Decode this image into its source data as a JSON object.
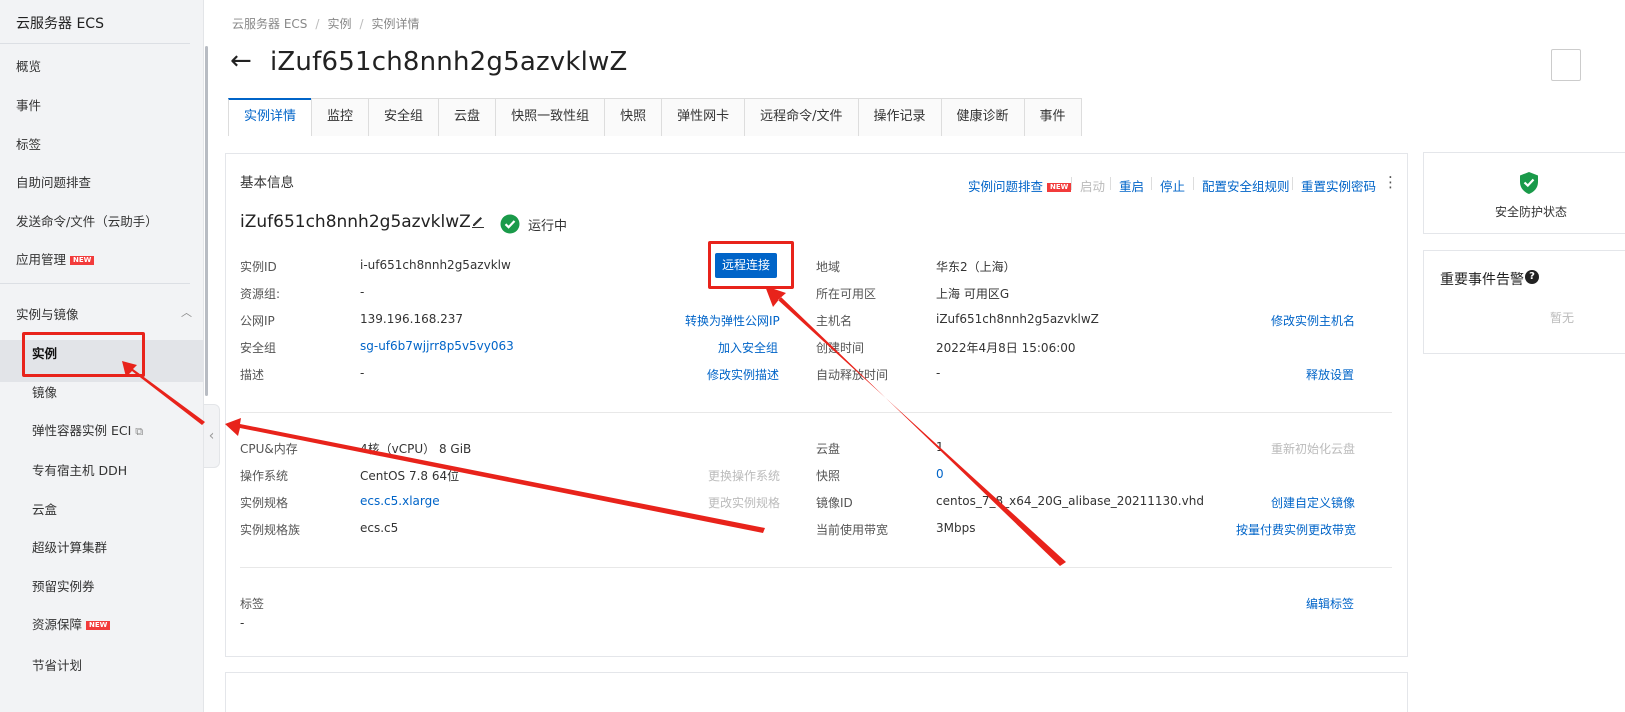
{
  "sidebar": {
    "title": "云服务器 ECS",
    "items": [
      {
        "label": "概览"
      },
      {
        "label": "事件"
      },
      {
        "label": "标签"
      },
      {
        "label": "自助问题排查"
      },
      {
        "label": "发送命令/文件（云助手）"
      },
      {
        "label": "应用管理",
        "badge": "NEW"
      }
    ],
    "group": {
      "label": "实例与镜像",
      "expanded": true
    },
    "sub_items": [
      {
        "label": "实例",
        "active": true
      },
      {
        "label": "镜像"
      },
      {
        "label": "弹性容器实例 ECI",
        "external": true
      },
      {
        "label": "专有宿主机 DDH"
      },
      {
        "label": "云盒"
      },
      {
        "label": "超级计算集群"
      },
      {
        "label": "预留实例券"
      },
      {
        "label": "资源保障",
        "badge": "NEW"
      },
      {
        "label": "节省计划"
      }
    ]
  },
  "breadcrumb": [
    "云服务器 ECS",
    "实例",
    "实例详情"
  ],
  "page_title": "iZuf651ch8nnh2g5azvklwZ",
  "tabs": [
    "实例详情",
    "监控",
    "安全组",
    "云盘",
    "快照一致性组",
    "快照",
    "弹性网卡",
    "远程命令/文件",
    "操作记录",
    "健康诊断",
    "事件"
  ],
  "active_tab": 0,
  "basic": {
    "section_title": "基本信息",
    "actions": [
      {
        "label": "实例问题排查",
        "badge": "NEW",
        "enabled": true
      },
      {
        "label": "启动",
        "enabled": false
      },
      {
        "label": "重启",
        "enabled": true
      },
      {
        "label": "停止",
        "enabled": true
      },
      {
        "label": "配置安全组规则",
        "enabled": true
      },
      {
        "label": "重置实例密码",
        "enabled": true
      }
    ],
    "instance_name": "iZuf651ch8nnh2g5azvklwZ",
    "status": "运行中",
    "remote_connect": "远程连接",
    "left_rows": [
      {
        "label": "实例ID",
        "value": "i-uf651ch8nnh2g5azvklw",
        "action": ""
      },
      {
        "label": "资源组:",
        "value": "-",
        "action": ""
      },
      {
        "label": "公网IP",
        "value": "139.196.168.237",
        "action": "转换为弹性公网IP"
      },
      {
        "label": "安全组",
        "value": "sg-uf6b7wjjrr8p5v5vy063",
        "action": "加入安全组"
      },
      {
        "label": "描述",
        "value": "-",
        "action": "修改实例描述"
      }
    ],
    "right_rows": [
      {
        "label": "地域",
        "value": "华东2（上海）",
        "action": ""
      },
      {
        "label": "所在可用区",
        "value": "上海 可用区G",
        "action": ""
      },
      {
        "label": "主机名",
        "value": "iZuf651ch8nnh2g5azvklwZ",
        "action": "修改实例主机名"
      },
      {
        "label": "创建时间",
        "value": "2022年4月8日 15:06:00",
        "action": ""
      },
      {
        "label": "自动释放时间",
        "value": "-",
        "action": "释放设置"
      }
    ]
  },
  "config": {
    "left_rows": [
      {
        "label": "CPU&内存",
        "value": "4核（vCPU） 8 GiB",
        "action": ""
      },
      {
        "label": "操作系统",
        "value": "CentOS 7.8 64位",
        "action": "更换操作系统"
      },
      {
        "label": "实例规格",
        "value": "ecs.c5.xlarge",
        "action": "更改实例规格"
      },
      {
        "label": "实例规格族",
        "value": "ecs.c5",
        "action": ""
      }
    ],
    "right_rows": [
      {
        "label": "云盘",
        "value": "1",
        "action": "重新初始化云盘"
      },
      {
        "label": "快照",
        "value": "0",
        "action": ""
      },
      {
        "label": "镜像ID",
        "value": "centos_7_8_x64_20G_alibase_20211130.vhd",
        "action": "创建自定义镜像"
      },
      {
        "label": "当前使用带宽",
        "value": "3Mbps",
        "action": "按量付费实例更改带宽"
      }
    ]
  },
  "tags": {
    "label": "标签",
    "value": "-",
    "action": "编辑标签"
  },
  "side": {
    "security_status": "安全防护状态",
    "events_title": "重要事件告警",
    "events_empty": "暂无"
  },
  "colors": {
    "link": "#0064c8",
    "annotation": "#e8231b",
    "status_ok": "#1a9a4a"
  }
}
